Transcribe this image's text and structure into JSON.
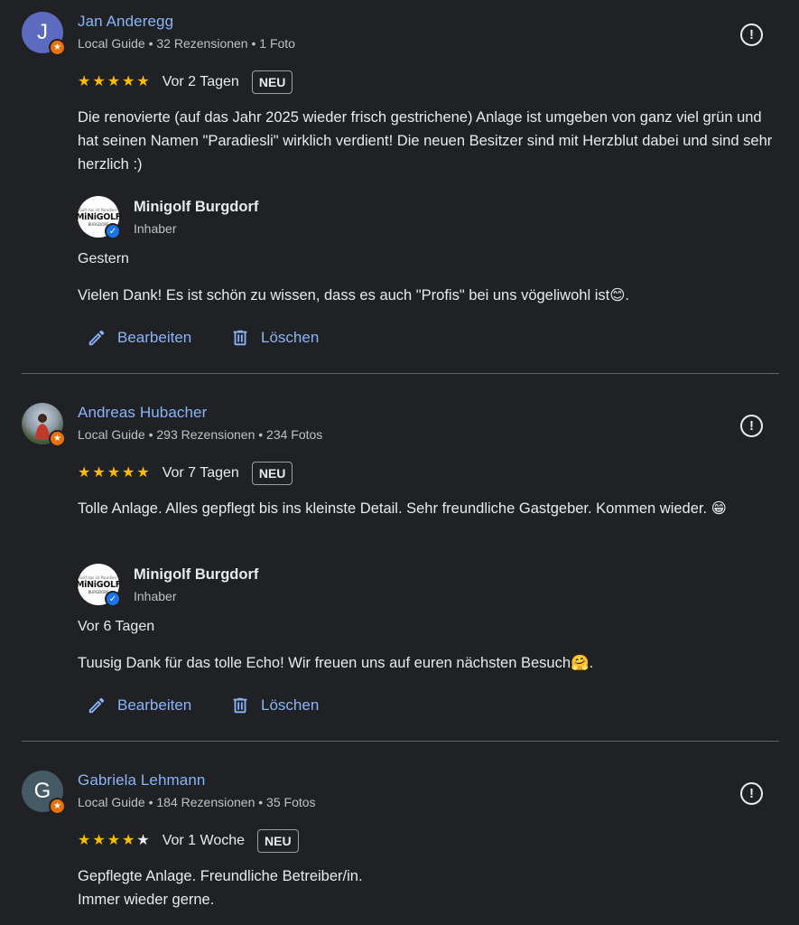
{
  "reviews": [
    {
      "avatar_letter": "J",
      "avatar_color": "#5c6bc0",
      "name": "Jan Anderegg",
      "meta": "Local Guide • 32 Rezensionen • 1 Foto",
      "stars": 5,
      "date": "Vor 2 Tagen",
      "badge": "NEU",
      "text": "Die renovierte (auf das Jahr 2025 wieder frisch gestrichene) Anlage ist umgeben von ganz viel grün und hat seinen Namen \"Paradiesli\" wirklich verdient! Die neuen Besitzer sind mit Herzblut dabei und sind sehr herzlich :)",
      "reply": {
        "owner_name": "Minigolf Burgdorf",
        "owner_role": "Inhaber",
        "date": "Gestern",
        "text": "Vielen Dank! Es ist schön zu wissen, dass es auch \"Profis\" bei uns vögeliwohl ist😊."
      }
    },
    {
      "avatar_letter": "",
      "name": "Andreas Hubacher",
      "meta": "Local Guide • 293 Rezensionen • 234 Fotos",
      "stars": 5,
      "date": "Vor 7 Tagen",
      "badge": "NEU",
      "text": "Tolle Anlage. Alles gepflegt bis ins kleinste Detail. Sehr freundliche Gastgeber. Kommen wieder. 😁",
      "reply": {
        "owner_name": "Minigolf Burgdorf",
        "owner_role": "Inhaber",
        "date": "Vor 6 Tagen",
        "text": "Tuusig Dank für das tolle Echo! Wir freuen uns auf euren nächsten Besuch🤗."
      }
    },
    {
      "avatar_letter": "G",
      "avatar_color": "#455a64",
      "name": "Gabriela Lehmann",
      "meta": "Local Guide • 184 Rezensionen • 35 Fotos",
      "stars": 4,
      "date": "Vor 1 Woche",
      "badge": "NEU",
      "text": "Gepflegte Anlage. Freundliche Betreiber/in.\nImmer wieder gerne."
    }
  ],
  "owner_logo": {
    "small_text": "Golf das ist Paradies!",
    "brand": "MiNiGOLF",
    "sub": "BURGDORF"
  },
  "actions": {
    "edit_label": "Bearbeiten",
    "delete_label": "Löschen"
  },
  "icons": {
    "report": "report-flag-icon",
    "edit": "pencil-icon",
    "delete": "trash-icon",
    "star": "star-icon"
  },
  "colors": {
    "background": "#202124",
    "link": "#8ab4f8",
    "star": "#fbbc04",
    "guide_badge": "#e8710a",
    "verified": "#1a73e8"
  }
}
